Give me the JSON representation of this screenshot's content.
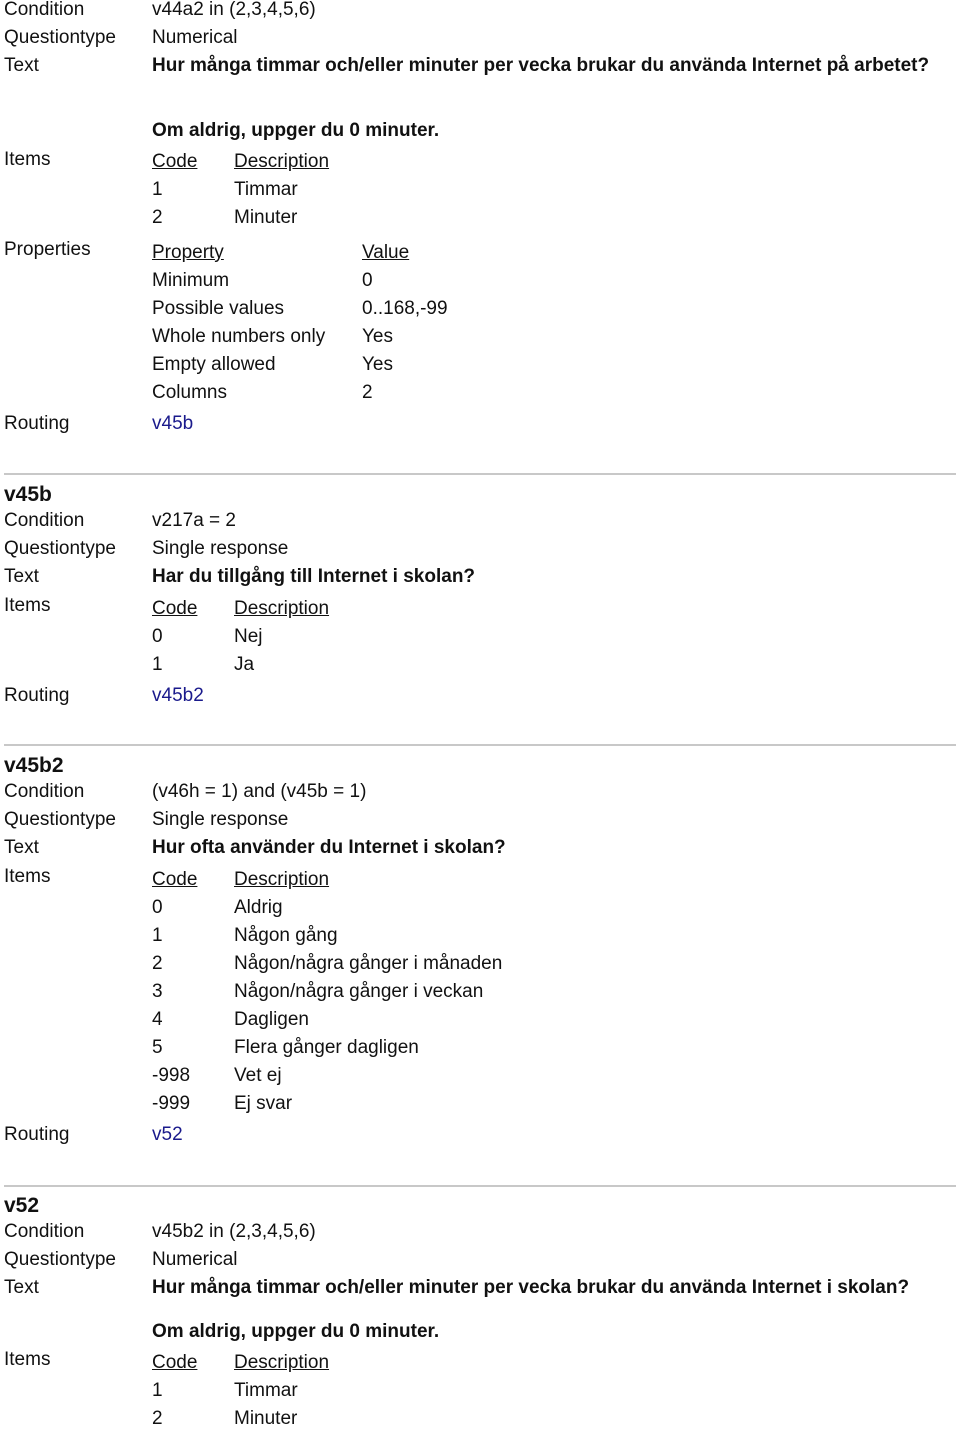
{
  "section1": {
    "condition_label": "Condition",
    "condition": "v44a2 in (2,3,4,5,6)",
    "questiontype_label": "Questiontype",
    "questiontype": "Numerical",
    "text_label": "Text",
    "text": "Hur många timmar och/eller minuter per vecka brukar du använda Internet på arbetet?",
    "text2": "Om aldrig, uppger du 0 minuter.",
    "items_label": "Items",
    "code_header": "Code",
    "description_header": "Description",
    "items": [
      {
        "code": "1",
        "description": "Timmar"
      },
      {
        "code": "2",
        "description": "Minuter"
      }
    ],
    "properties_label": "Properties",
    "property_header": "Property",
    "value_header": "Value",
    "properties": [
      {
        "property": "Minimum",
        "value": "0"
      },
      {
        "property": "Possible values",
        "value": "0..168,-99"
      },
      {
        "property": "Whole numbers only",
        "value": "Yes"
      },
      {
        "property": "Empty allowed",
        "value": "Yes"
      },
      {
        "property": "Columns",
        "value": "2"
      }
    ],
    "routing_label": "Routing",
    "routing": "v45b"
  },
  "section2": {
    "title": "v45b",
    "condition_label": "Condition",
    "condition": "v217a = 2",
    "questiontype_label": "Questiontype",
    "questiontype": "Single response",
    "text_label": "Text",
    "text": "Har du tillgång till Internet i skolan?",
    "items_label": "Items",
    "code_header": "Code",
    "description_header": "Description",
    "items": [
      {
        "code": "0",
        "description": "Nej"
      },
      {
        "code": "1",
        "description": "Ja"
      }
    ],
    "routing_label": "Routing",
    "routing": "v45b2"
  },
  "section3": {
    "title": "v45b2",
    "condition_label": "Condition",
    "condition": "(v46h = 1) and (v45b = 1)",
    "questiontype_label": "Questiontype",
    "questiontype": "Single response",
    "text_label": "Text",
    "text": "Hur ofta använder du Internet i skolan?",
    "items_label": "Items",
    "code_header": "Code",
    "description_header": "Description",
    "items": [
      {
        "code": "0",
        "description": "Aldrig"
      },
      {
        "code": "1",
        "description": "Någon gång"
      },
      {
        "code": "2",
        "description": "Någon/några gånger i månaden"
      },
      {
        "code": "3",
        "description": "Någon/några gånger i veckan"
      },
      {
        "code": "4",
        "description": "Dagligen"
      },
      {
        "code": "5",
        "description": "Flera gånger dagligen"
      },
      {
        "code": "-998",
        "description": "Vet ej"
      },
      {
        "code": "-999",
        "description": "Ej svar"
      }
    ],
    "routing_label": "Routing",
    "routing": "v52"
  },
  "section4": {
    "title": "v52",
    "condition_label": "Condition",
    "condition": "v45b2 in (2,3,4,5,6)",
    "questiontype_label": "Questiontype",
    "questiontype": "Numerical",
    "text_label": "Text",
    "text": "Hur många timmar och/eller minuter per vecka brukar du använda Internet i skolan?",
    "text2": "Om aldrig, uppger du 0 minuter.",
    "items_label": "Items",
    "code_header": "Code",
    "description_header": "Description",
    "items": [
      {
        "code": "1",
        "description": "Timmar"
      },
      {
        "code": "2",
        "description": "Minuter"
      }
    ]
  }
}
